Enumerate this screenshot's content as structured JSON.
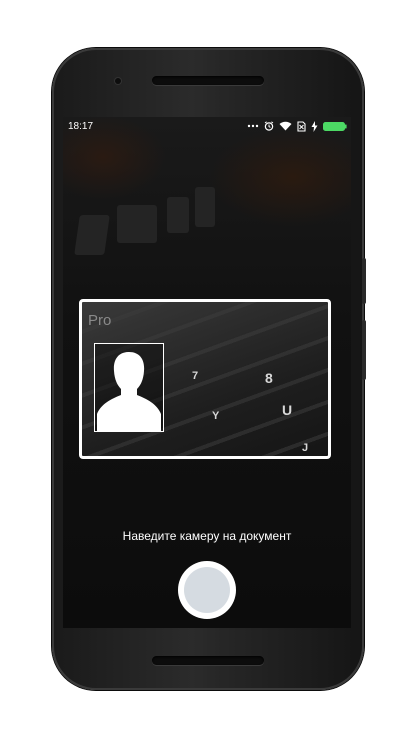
{
  "status_bar": {
    "time": "18:17",
    "icons": [
      "more-dots-icon",
      "alarm-icon",
      "wifi-icon",
      "no-sim-icon",
      "charging-icon",
      "battery-icon"
    ]
  },
  "capture": {
    "hint": "Наведите камеру на документ",
    "shutter_label": ""
  },
  "colors": {
    "frame": "#ffffff",
    "shutter_inner": "#d5dbe1",
    "battery": "#4cd964"
  }
}
